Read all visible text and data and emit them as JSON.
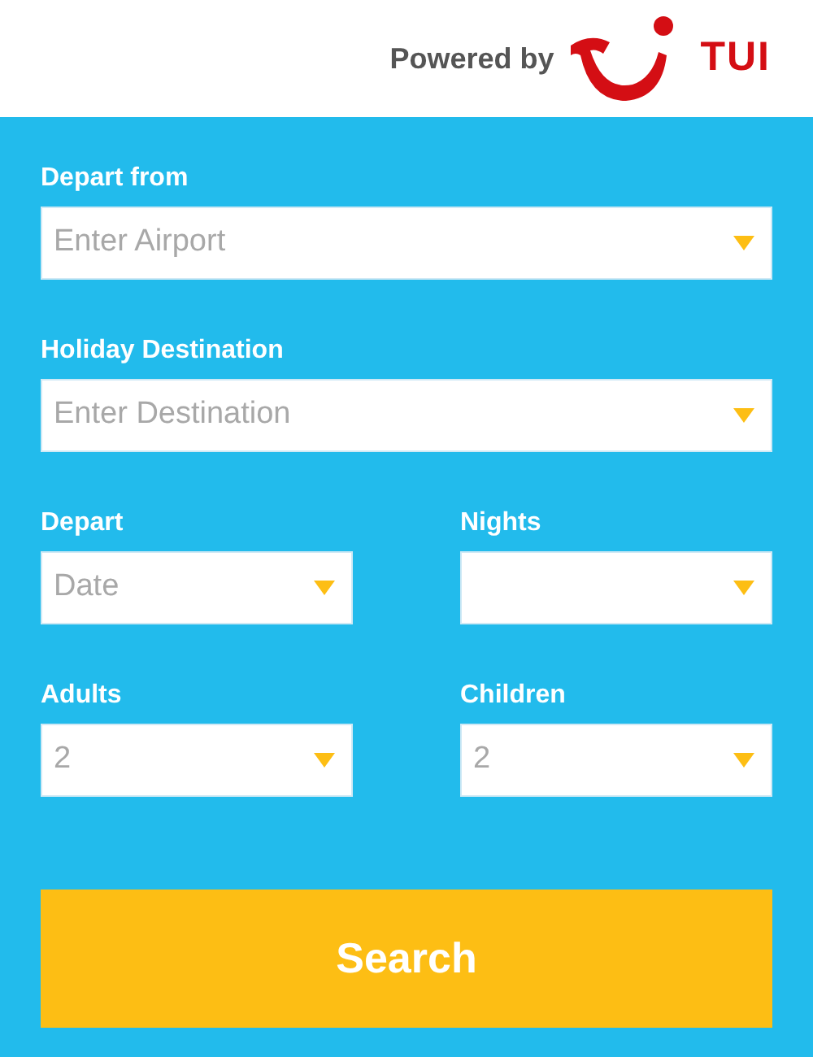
{
  "header": {
    "powered_by": "Powered by",
    "logo_text": "TUI"
  },
  "rows": [
    {
      "fields": [
        {
          "label": "Depart from",
          "placeholder": "Enter Airport"
        }
      ]
    },
    {
      "fields": [
        {
          "label": "Holiday Destination",
          "placeholder": "Enter Destination"
        }
      ]
    },
    {
      "fields": [
        {
          "label": "Depart",
          "placeholder": "Date"
        },
        {
          "label": "Nights"
        }
      ]
    },
    {
      "fields": [
        {
          "label": "Adults",
          "value": "2"
        },
        {
          "label": "Children",
          "value": "2"
        }
      ]
    }
  ],
  "search_button": "Search"
}
